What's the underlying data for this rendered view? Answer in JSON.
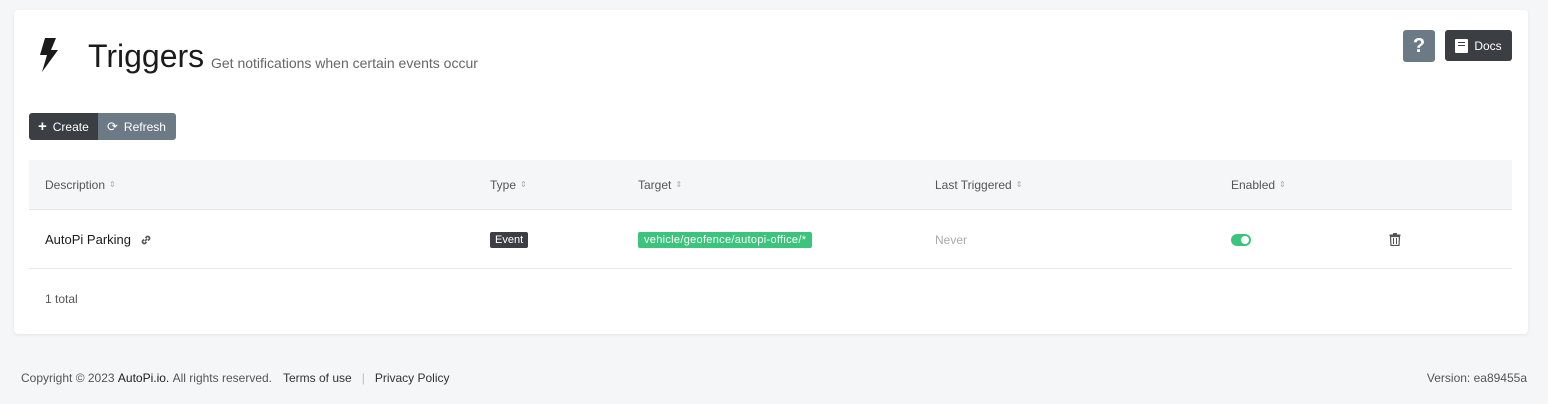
{
  "header": {
    "title": "Triggers",
    "subtitle": "Get notifications when certain events occur",
    "help_label": "?",
    "docs_label": "Docs"
  },
  "toolbar": {
    "create_label": "Create",
    "refresh_label": "Refresh"
  },
  "table": {
    "columns": [
      "Description",
      "Type",
      "Target",
      "Last Triggered",
      "Enabled"
    ],
    "rows": [
      {
        "description": "AutoPi Parking",
        "type": "Event",
        "target": "vehicle/geofence/autopi-office/*",
        "last_triggered": "Never",
        "enabled": true
      }
    ],
    "total": "1 total"
  },
  "footer": {
    "copyright": "Copyright © 2023",
    "brand": "AutoPi.io.",
    "rights": "All rights reserved.",
    "terms": "Terms of use",
    "separator": "|",
    "privacy": "Privacy Policy",
    "version": "Version: ea89455a"
  },
  "colors": {
    "accent_green": "#3cc47c",
    "dark": "#3b3e42",
    "slate": "#6c7a86"
  },
  "icons": {
    "page": "lightning-bolt-icon",
    "create": "plus-icon",
    "refresh": "refresh-icon",
    "docs": "book-icon",
    "row_link": "link-icon",
    "row_delete": "trash-icon"
  }
}
